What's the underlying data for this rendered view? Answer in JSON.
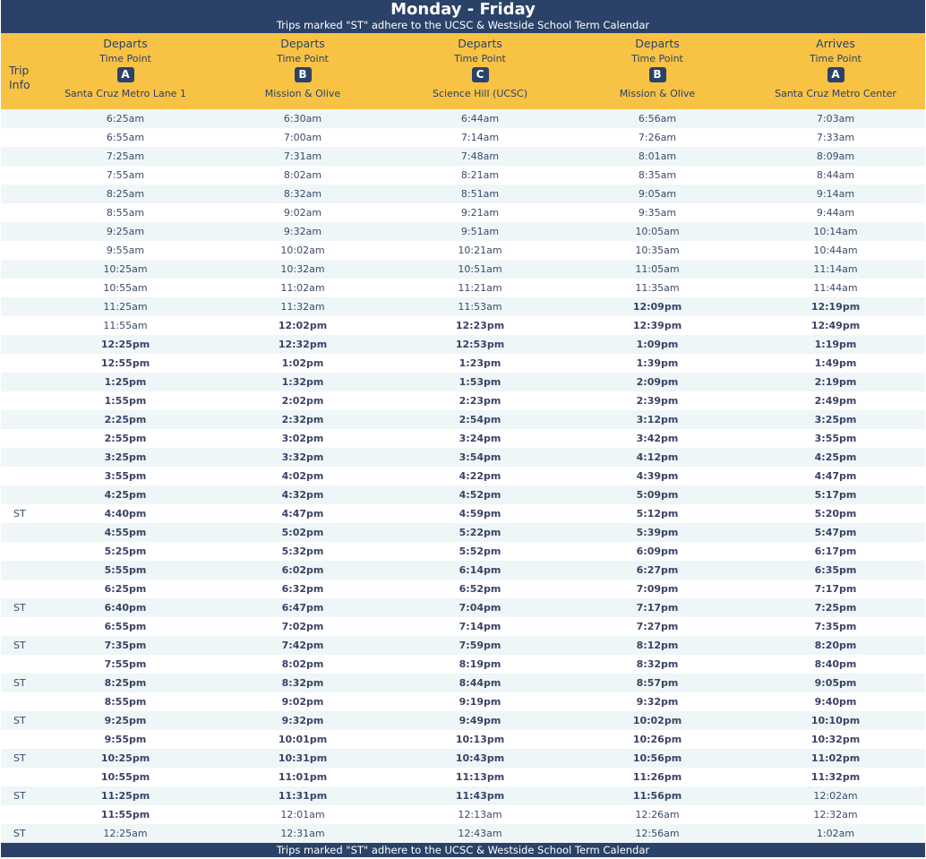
{
  "header": {
    "title": "Monday - Friday",
    "note": "Trips marked \"ST\" adhere to the UCSC & Westside School Term Calendar"
  },
  "columns": {
    "trip_info_line1": "Trip",
    "trip_info_line2": "Info",
    "stops": [
      {
        "kind": "Departs",
        "tp_label": "Time Point",
        "badge": "A",
        "name": "Santa Cruz Metro Lane 1"
      },
      {
        "kind": "Departs",
        "tp_label": "Time Point",
        "badge": "B",
        "name": "Mission & Olive"
      },
      {
        "kind": "Departs",
        "tp_label": "Time Point",
        "badge": "C",
        "name": "Science Hill (UCSC)"
      },
      {
        "kind": "Departs",
        "tp_label": "Time Point",
        "badge": "B",
        "name": "Mission & Olive"
      },
      {
        "kind": "Arrives",
        "tp_label": "Time Point",
        "badge": "A",
        "name": "Santa Cruz Metro Center"
      }
    ]
  },
  "rows": [
    {
      "trip": "",
      "times": [
        "6:25am",
        "6:30am",
        "6:44am",
        "6:56am",
        "7:03am"
      ]
    },
    {
      "trip": "",
      "times": [
        "6:55am",
        "7:00am",
        "7:14am",
        "7:26am",
        "7:33am"
      ]
    },
    {
      "trip": "",
      "times": [
        "7:25am",
        "7:31am",
        "7:48am",
        "8:01am",
        "8:09am"
      ]
    },
    {
      "trip": "",
      "times": [
        "7:55am",
        "8:02am",
        "8:21am",
        "8:35am",
        "8:44am"
      ]
    },
    {
      "trip": "",
      "times": [
        "8:25am",
        "8:32am",
        "8:51am",
        "9:05am",
        "9:14am"
      ]
    },
    {
      "trip": "",
      "times": [
        "8:55am",
        "9:02am",
        "9:21am",
        "9:35am",
        "9:44am"
      ]
    },
    {
      "trip": "",
      "times": [
        "9:25am",
        "9:32am",
        "9:51am",
        "10:05am",
        "10:14am"
      ]
    },
    {
      "trip": "",
      "times": [
        "9:55am",
        "10:02am",
        "10:21am",
        "10:35am",
        "10:44am"
      ]
    },
    {
      "trip": "",
      "times": [
        "10:25am",
        "10:32am",
        "10:51am",
        "11:05am",
        "11:14am"
      ]
    },
    {
      "trip": "",
      "times": [
        "10:55am",
        "11:02am",
        "11:21am",
        "11:35am",
        "11:44am"
      ]
    },
    {
      "trip": "",
      "times": [
        "11:25am",
        "11:32am",
        "11:53am",
        "12:09pm",
        "12:19pm"
      ]
    },
    {
      "trip": "",
      "times": [
        "11:55am",
        "12:02pm",
        "12:23pm",
        "12:39pm",
        "12:49pm"
      ]
    },
    {
      "trip": "",
      "times": [
        "12:25pm",
        "12:32pm",
        "12:53pm",
        "1:09pm",
        "1:19pm"
      ]
    },
    {
      "trip": "",
      "times": [
        "12:55pm",
        "1:02pm",
        "1:23pm",
        "1:39pm",
        "1:49pm"
      ]
    },
    {
      "trip": "",
      "times": [
        "1:25pm",
        "1:32pm",
        "1:53pm",
        "2:09pm",
        "2:19pm"
      ]
    },
    {
      "trip": "",
      "times": [
        "1:55pm",
        "2:02pm",
        "2:23pm",
        "2:39pm",
        "2:49pm"
      ]
    },
    {
      "trip": "",
      "times": [
        "2:25pm",
        "2:32pm",
        "2:54pm",
        "3:12pm",
        "3:25pm"
      ]
    },
    {
      "trip": "",
      "times": [
        "2:55pm",
        "3:02pm",
        "3:24pm",
        "3:42pm",
        "3:55pm"
      ]
    },
    {
      "trip": "",
      "times": [
        "3:25pm",
        "3:32pm",
        "3:54pm",
        "4:12pm",
        "4:25pm"
      ]
    },
    {
      "trip": "",
      "times": [
        "3:55pm",
        "4:02pm",
        "4:22pm",
        "4:39pm",
        "4:47pm"
      ]
    },
    {
      "trip": "",
      "times": [
        "4:25pm",
        "4:32pm",
        "4:52pm",
        "5:09pm",
        "5:17pm"
      ]
    },
    {
      "trip": "ST",
      "times": [
        "4:40pm",
        "4:47pm",
        "4:59pm",
        "5:12pm",
        "5:20pm"
      ]
    },
    {
      "trip": "",
      "times": [
        "4:55pm",
        "5:02pm",
        "5:22pm",
        "5:39pm",
        "5:47pm"
      ]
    },
    {
      "trip": "",
      "times": [
        "5:25pm",
        "5:32pm",
        "5:52pm",
        "6:09pm",
        "6:17pm"
      ]
    },
    {
      "trip": "",
      "times": [
        "5:55pm",
        "6:02pm",
        "6:14pm",
        "6:27pm",
        "6:35pm"
      ]
    },
    {
      "trip": "",
      "times": [
        "6:25pm",
        "6:32pm",
        "6:52pm",
        "7:09pm",
        "7:17pm"
      ]
    },
    {
      "trip": "ST",
      "times": [
        "6:40pm",
        "6:47pm",
        "7:04pm",
        "7:17pm",
        "7:25pm"
      ]
    },
    {
      "trip": "",
      "times": [
        "6:55pm",
        "7:02pm",
        "7:14pm",
        "7:27pm",
        "7:35pm"
      ]
    },
    {
      "trip": "ST",
      "times": [
        "7:35pm",
        "7:42pm",
        "7:59pm",
        "8:12pm",
        "8:20pm"
      ]
    },
    {
      "trip": "",
      "times": [
        "7:55pm",
        "8:02pm",
        "8:19pm",
        "8:32pm",
        "8:40pm"
      ]
    },
    {
      "trip": "ST",
      "times": [
        "8:25pm",
        "8:32pm",
        "8:44pm",
        "8:57pm",
        "9:05pm"
      ]
    },
    {
      "trip": "",
      "times": [
        "8:55pm",
        "9:02pm",
        "9:19pm",
        "9:32pm",
        "9:40pm"
      ]
    },
    {
      "trip": "ST",
      "times": [
        "9:25pm",
        "9:32pm",
        "9:49pm",
        "10:02pm",
        "10:10pm"
      ]
    },
    {
      "trip": "",
      "times": [
        "9:55pm",
        "10:01pm",
        "10:13pm",
        "10:26pm",
        "10:32pm"
      ]
    },
    {
      "trip": "ST",
      "times": [
        "10:25pm",
        "10:31pm",
        "10:43pm",
        "10:56pm",
        "11:02pm"
      ]
    },
    {
      "trip": "",
      "times": [
        "10:55pm",
        "11:01pm",
        "11:13pm",
        "11:26pm",
        "11:32pm"
      ]
    },
    {
      "trip": "ST",
      "times": [
        "11:25pm",
        "11:31pm",
        "11:43pm",
        "11:56pm",
        "12:02am"
      ]
    },
    {
      "trip": "",
      "times": [
        "11:55pm",
        "12:01am",
        "12:13am",
        "12:26am",
        "12:32am"
      ]
    },
    {
      "trip": "ST",
      "times": [
        "12:25am",
        "12:31am",
        "12:43am",
        "12:56am",
        "1:02am"
      ]
    }
  ],
  "footer": {
    "note": "Trips marked \"ST\" adhere to the UCSC & Westside School Term Calendar"
  }
}
